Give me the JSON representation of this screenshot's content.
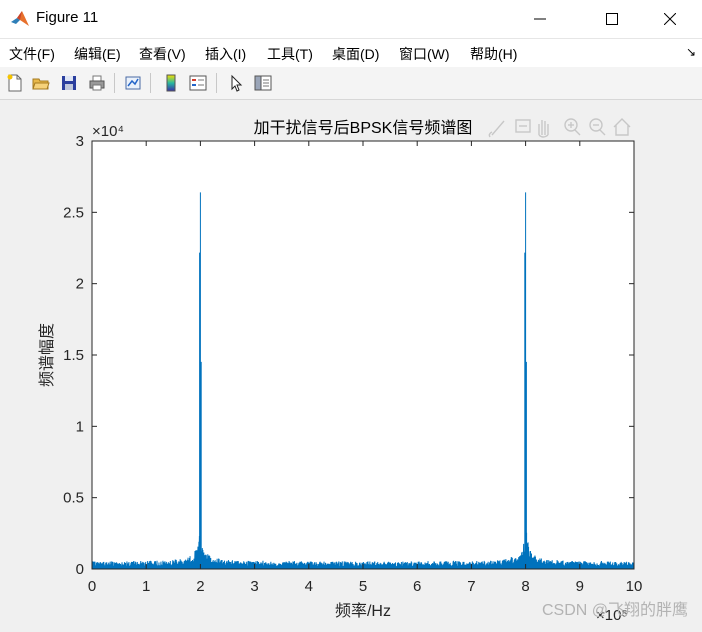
{
  "window": {
    "title": "Figure 11",
    "minimize_icon": "minimize-icon",
    "maximize_icon": "maximize-icon",
    "close_icon": "close-icon"
  },
  "menu": {
    "items": [
      "文件(F)",
      "编辑(E)",
      "查看(V)",
      "插入(I)",
      "工具(T)",
      "桌面(D)",
      "窗口(W)",
      "帮助(H)"
    ]
  },
  "toolbar": {
    "icons": [
      "new-figure-icon",
      "open-file-icon",
      "save-icon",
      "print-icon",
      "link-plot-icon",
      "colorbar-icon",
      "legend-icon",
      "pointer-icon",
      "property-editor-icon"
    ]
  },
  "axes_toolbar": {
    "icons": [
      "brush-icon",
      "data-tips-icon",
      "pan-icon",
      "zoom-in-icon",
      "zoom-out-icon",
      "home-icon"
    ]
  },
  "chart_data": {
    "type": "line",
    "title": "加干扰信号后BPSK信号频谱图",
    "xlabel": "频率/Hz",
    "ylabel": "频谱幅度",
    "x_exponent": "×10⁵",
    "y_exponent": "×10⁴",
    "xlim": [
      0,
      1000000
    ],
    "ylim": [
      0,
      30000
    ],
    "xtick_labels": [
      "0",
      "1",
      "2",
      "3",
      "4",
      "5",
      "6",
      "7",
      "8",
      "9",
      "10"
    ],
    "ytick_labels": [
      "0",
      "0.5",
      "1",
      "1.5",
      "2",
      "2.5",
      "3"
    ],
    "series_color": "#0072BD",
    "noise_floor": 400,
    "peaks": [
      {
        "x": 200000,
        "y": 26400
      },
      {
        "x": 800000,
        "y": 26400
      }
    ],
    "grid": false
  },
  "watermark": "CSDN @飞翔的胖鹰"
}
